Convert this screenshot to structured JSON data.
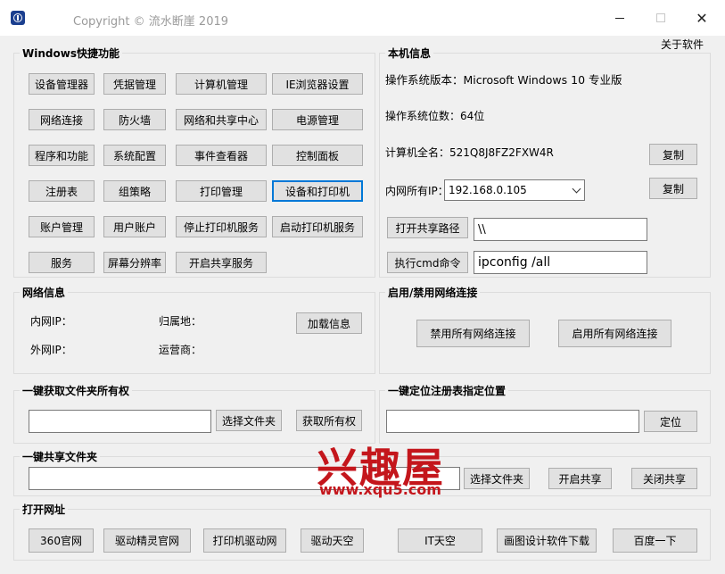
{
  "window": {
    "title": "Copyright © 流水断崖 2019",
    "minimize": "—",
    "maximize": "☐",
    "close": "✕"
  },
  "about": "关于软件",
  "shortcuts": {
    "title": "Windows快捷功能",
    "buttons": [
      "设备管理器",
      "凭据管理",
      "计算机管理",
      "IE浏览器设置",
      "网络连接",
      "防火墙",
      "网络和共享中心",
      "电源管理",
      "程序和功能",
      "系统配置",
      "事件查看器",
      "控制面板",
      "注册表",
      "组策略",
      "打印管理",
      "设备和打印机",
      "账户管理",
      "用户账户",
      "停止打印机服务",
      "启动打印机服务",
      "服务",
      "屏幕分辨率",
      "开启共享服务"
    ]
  },
  "local_info": {
    "title": "本机信息",
    "os_version": "操作系统版本：Microsoft Windows 10 专业版",
    "os_bits": "操作系统位数：64位",
    "computer_name": "计算机全名：521Q8J8FZ2FXW4R",
    "copy1": "复制",
    "lan_ip_label": "内网所有IP：",
    "lan_ip_value": "192.168.0.105",
    "copy2": "复制",
    "open_share_button": "打开共享路径",
    "share_path_value": "\\\\",
    "run_cmd_button": "执行cmd命令",
    "cmd_value": "ipconfig /all"
  },
  "network_info": {
    "title": "网络信息",
    "lan_ip": "内网IP：",
    "location": "归属地：",
    "wan_ip": "外网IP：",
    "isp": "运营商：",
    "load_button": "加载信息"
  },
  "net_toggle": {
    "title": "启用/禁用网络连接",
    "disable_button": "禁用所有网络连接",
    "enable_button": "启用所有网络连接"
  },
  "ownership": {
    "title": "一键获取文件夹所有权",
    "path_value": "",
    "select_button": "选择文件夹",
    "take_button": "获取所有权"
  },
  "registry_locate": {
    "title": "一键定位注册表指定位置",
    "path_value": "",
    "locate_button": "定位"
  },
  "share_folder": {
    "title": "一键共享文件夹",
    "path_value": "",
    "select_button": "选择文件夹",
    "open_button": "开启共享",
    "close_button": "关闭共享"
  },
  "open_url": {
    "title": "打开网址",
    "buttons": [
      "360官网",
      "驱动精灵官网",
      "打印机驱动网",
      "驱动天空",
      "IT天空",
      "画图设计软件下载",
      "百度一下"
    ]
  },
  "watermark": {
    "logo_text": "兴趣屋",
    "url": "www.xqu5.com"
  }
}
